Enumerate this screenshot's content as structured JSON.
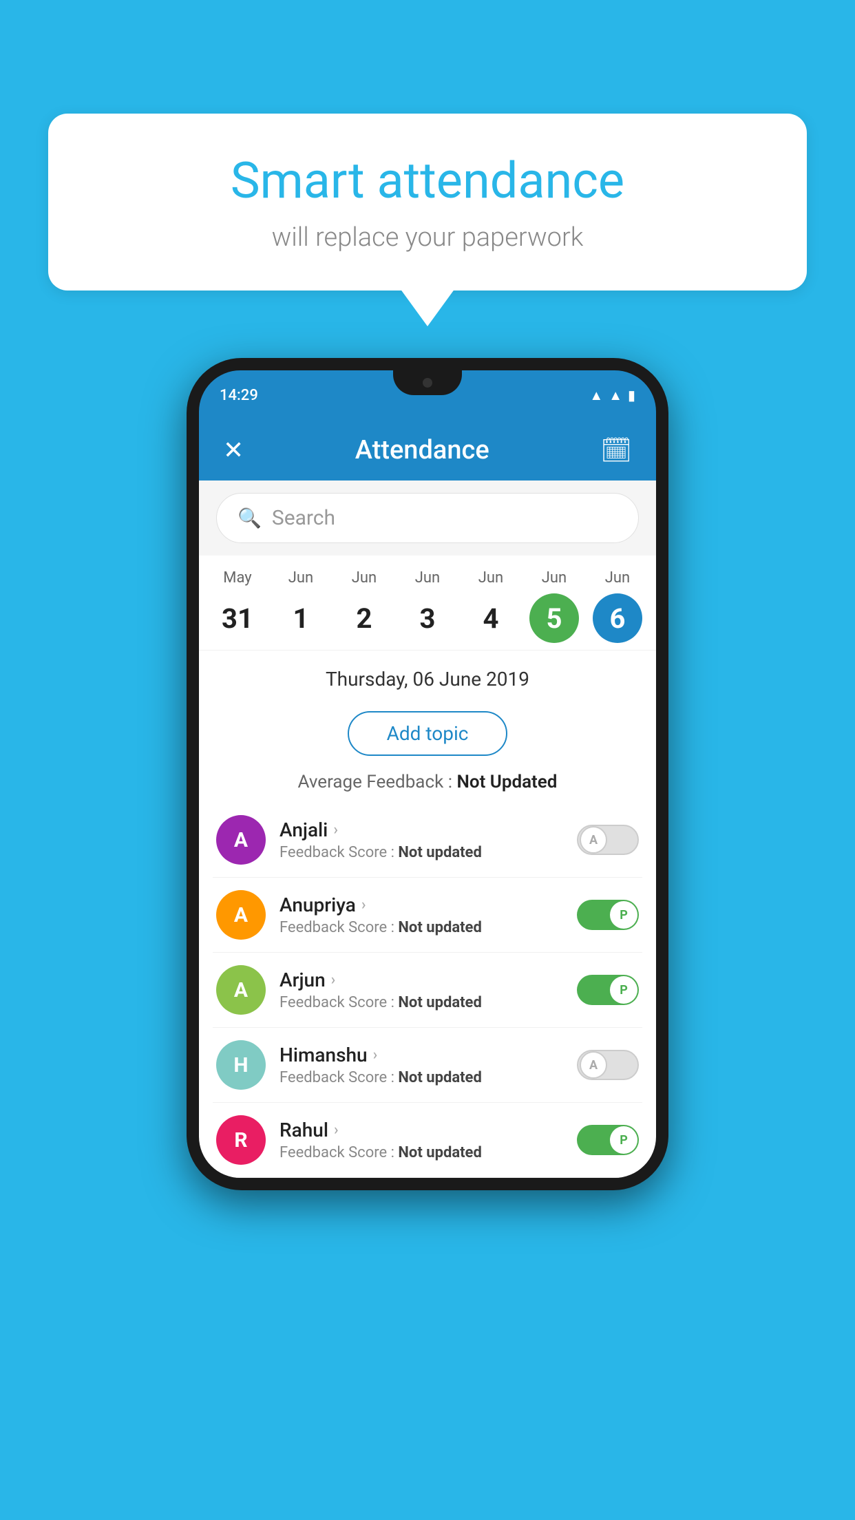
{
  "background": {
    "color": "#29b6e8"
  },
  "speech_bubble": {
    "title": "Smart attendance",
    "subtitle": "will replace your paperwork"
  },
  "status_bar": {
    "time": "14:29",
    "icons": [
      "wifi",
      "signal",
      "battery"
    ]
  },
  "app_header": {
    "title": "Attendance",
    "close_label": "✕",
    "calendar_label": "📅"
  },
  "search": {
    "placeholder": "Search"
  },
  "calendar": {
    "days": [
      {
        "month": "May",
        "num": "31",
        "state": "normal"
      },
      {
        "month": "Jun",
        "num": "1",
        "state": "normal"
      },
      {
        "month": "Jun",
        "num": "2",
        "state": "normal"
      },
      {
        "month": "Jun",
        "num": "3",
        "state": "normal"
      },
      {
        "month": "Jun",
        "num": "4",
        "state": "normal"
      },
      {
        "month": "Jun",
        "num": "5",
        "state": "today"
      },
      {
        "month": "Jun",
        "num": "6",
        "state": "selected"
      }
    ]
  },
  "selected_date": {
    "text": "Thursday, 06 June 2019"
  },
  "add_topic_button": {
    "label": "Add topic"
  },
  "average_feedback": {
    "label": "Average Feedback :",
    "value": "Not Updated"
  },
  "students": [
    {
      "name": "Anjali",
      "initial": "A",
      "avatar_color": "purple",
      "feedback": "Not updated",
      "attendance": "absent"
    },
    {
      "name": "Anupriya",
      "initial": "A",
      "avatar_color": "orange",
      "feedback": "Not updated",
      "attendance": "present"
    },
    {
      "name": "Arjun",
      "initial": "A",
      "avatar_color": "green",
      "feedback": "Not updated",
      "attendance": "present"
    },
    {
      "name": "Himanshu",
      "initial": "H",
      "avatar_color": "teal",
      "feedback": "Not updated",
      "attendance": "absent"
    },
    {
      "name": "Rahul",
      "initial": "R",
      "avatar_color": "pink",
      "feedback": "Not updated",
      "attendance": "present"
    }
  ],
  "attendance_labels": {
    "absent": "A",
    "present": "P"
  }
}
